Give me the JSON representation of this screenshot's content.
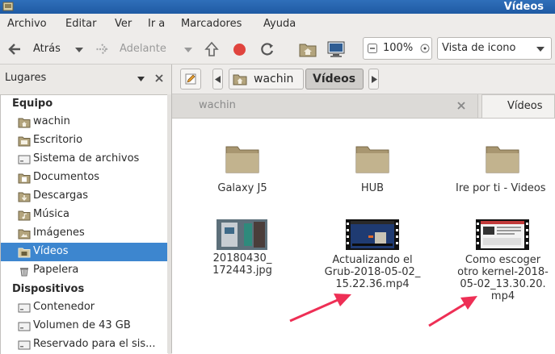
{
  "window": {
    "title": "Vídeos"
  },
  "menu": [
    "Archivo",
    "Editar",
    "Ver",
    "Ir a",
    "Marcadores",
    "Ayuda"
  ],
  "toolbar": {
    "back": "Atrás",
    "forward": "Adelante",
    "zoom": "100%",
    "view_mode": "Vista de icono"
  },
  "sidebar": {
    "title": "Lugares",
    "sections": [
      {
        "label": "Equipo",
        "items": [
          {
            "label": "wachin",
            "icon": "home-folder-icon"
          },
          {
            "label": "Escritorio",
            "icon": "desktop-folder-icon"
          },
          {
            "label": "Sistema de archivos",
            "icon": "drive-icon"
          },
          {
            "label": "Documentos",
            "icon": "documents-folder-icon"
          },
          {
            "label": "Descargas",
            "icon": "downloads-folder-icon"
          },
          {
            "label": "Música",
            "icon": "music-folder-icon"
          },
          {
            "label": "Imágenes",
            "icon": "pictures-folder-icon"
          },
          {
            "label": "Vídeos",
            "icon": "videos-folder-icon",
            "selected": true
          },
          {
            "label": "Papelera",
            "icon": "trash-icon"
          }
        ]
      },
      {
        "label": "Dispositivos",
        "items": [
          {
            "label": "Contenedor",
            "icon": "drive-icon"
          },
          {
            "label": "Volumen de 43 GB",
            "icon": "drive-icon"
          },
          {
            "label": "Reservado para el sis...",
            "icon": "drive-icon"
          }
        ]
      }
    ]
  },
  "pathbar": {
    "segments": [
      "wachin",
      "Vídeos"
    ]
  },
  "tabs": [
    {
      "label": "wachin"
    },
    {
      "label": "Vídeos",
      "active": true
    }
  ],
  "files": [
    {
      "name": "Galaxy J5",
      "type": "folder"
    },
    {
      "name": "HUB",
      "type": "folder"
    },
    {
      "name": "Ire por ti - Videos",
      "type": "folder"
    },
    {
      "name_lines": [
        "20180430_",
        "172443.jpg"
      ],
      "type": "image"
    },
    {
      "name_lines": [
        "Actualizando el",
        "Grub-2018-05-02_",
        "15.22.36.mp4"
      ],
      "type": "video"
    },
    {
      "name_lines": [
        "Como escoger",
        "otro kernel-2018-",
        "05-02_13.30.20.",
        "mp4"
      ],
      "type": "video"
    }
  ],
  "colors": {
    "selection": "#3d86cf",
    "titlebar": "#2265ad",
    "arrow": "#ee2f55"
  }
}
